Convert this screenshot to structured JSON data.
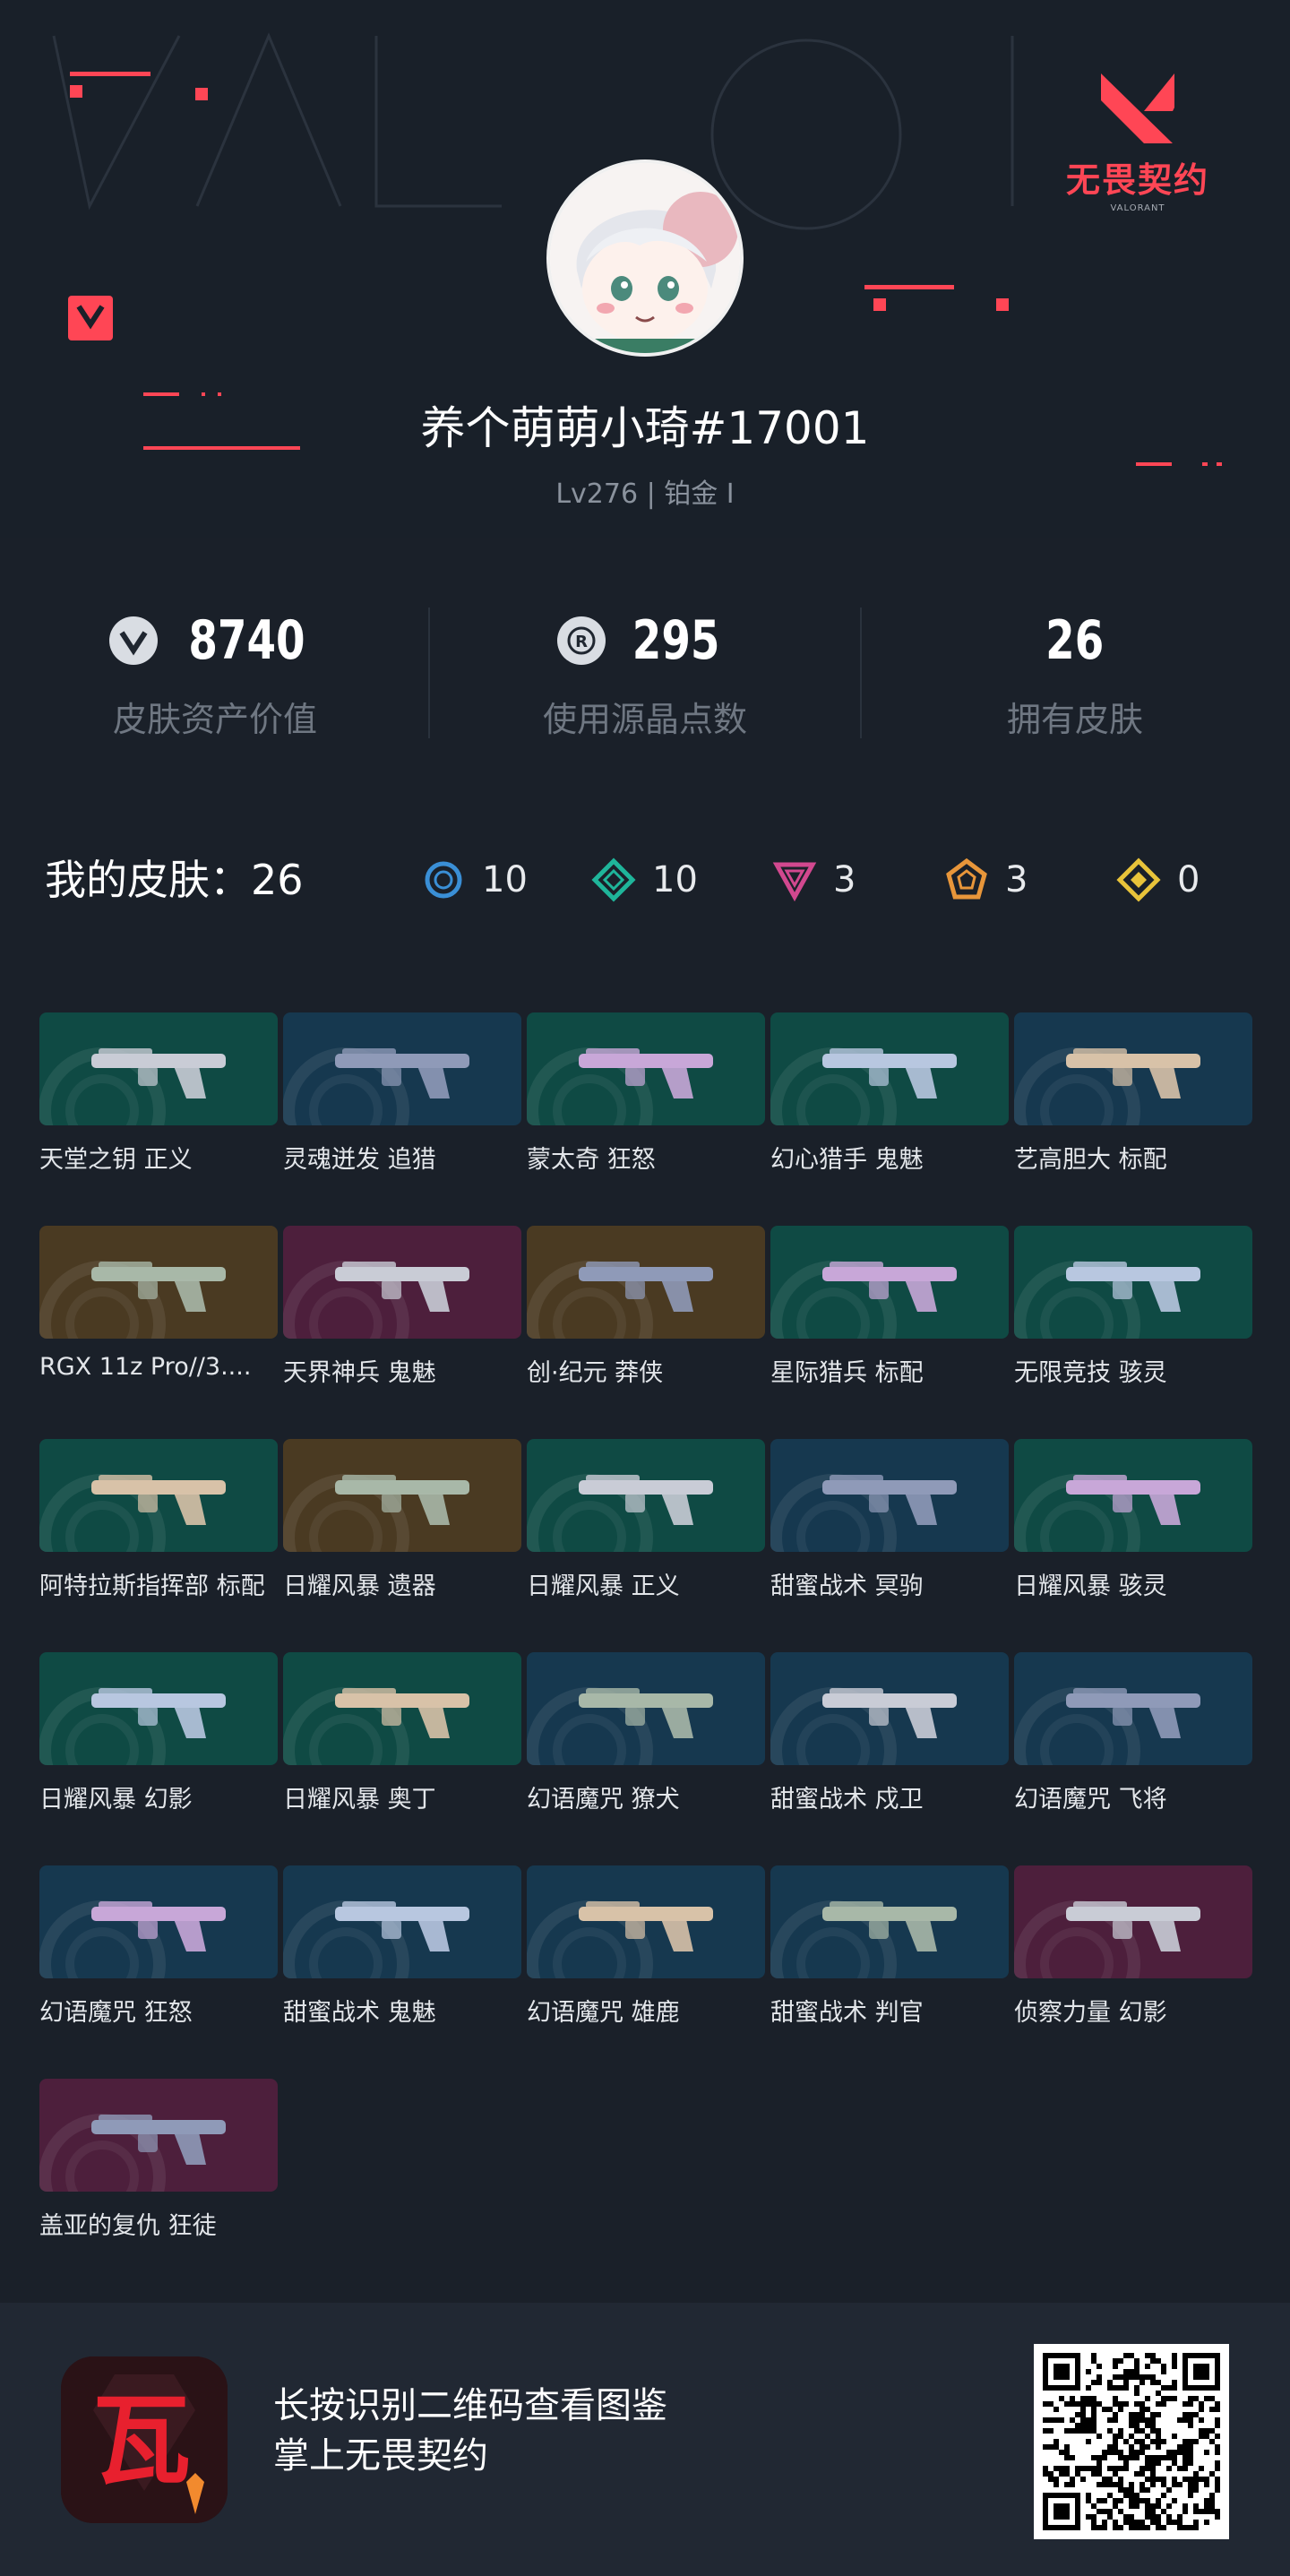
{
  "header": {
    "brand_name": "无畏契约",
    "brand_sub": "VALORANT"
  },
  "profile": {
    "name": "养个萌萌小琦#17001",
    "level": "Lv276 | 铂金 I"
  },
  "stats": [
    {
      "icon": "vp-icon",
      "value": "8740",
      "label": "皮肤资产价值"
    },
    {
      "icon": "radianite-icon",
      "value": "295",
      "label": "使用源晶点数"
    },
    {
      "icon": "",
      "value": "26",
      "label": "拥有皮肤"
    }
  ],
  "summary": {
    "title": "我的皮肤：26",
    "tiers": [
      {
        "icon": "select-tier-icon",
        "color": "#3a8fd6",
        "count": "10"
      },
      {
        "icon": "deluxe-tier-icon",
        "color": "#1fb59a",
        "count": "10"
      },
      {
        "icon": "premium-tier-icon",
        "color": "#d2488f",
        "count": "3"
      },
      {
        "icon": "exclusive-tier-icon",
        "color": "#e8963a",
        "count": "3"
      },
      {
        "icon": "ultra-tier-icon",
        "color": "#e8c33a",
        "count": "0"
      }
    ]
  },
  "skins": [
    {
      "name": "天堂之钥 正义",
      "tier": "deluxe"
    },
    {
      "name": "灵魂迸发 追猎",
      "tier": "select"
    },
    {
      "name": "蒙太奇 狂怒",
      "tier": "deluxe"
    },
    {
      "name": "幻心猎手 鬼魅",
      "tier": "deluxe"
    },
    {
      "name": "艺高胆大 标配",
      "tier": "select"
    },
    {
      "name": "RGX 11z Pro//3....",
      "tier": "exclusive"
    },
    {
      "name": "天界神兵 鬼魅",
      "tier": "premium"
    },
    {
      "name": "创·纪元 莽侠",
      "tier": "exclusive"
    },
    {
      "name": "星际猎兵 标配",
      "tier": "deluxe"
    },
    {
      "name": "无限竞技 骇灵",
      "tier": "deluxe"
    },
    {
      "name": "阿特拉斯指挥部 标配",
      "tier": "deluxe"
    },
    {
      "name": "日耀风暴 遗器",
      "tier": "exclusive"
    },
    {
      "name": "日耀风暴 正义",
      "tier": "deluxe"
    },
    {
      "name": "甜蜜战术 冥驹",
      "tier": "select"
    },
    {
      "name": "日耀风暴 骇灵",
      "tier": "deluxe"
    },
    {
      "name": "日耀风暴 幻影",
      "tier": "deluxe"
    },
    {
      "name": "日耀风暴 奥丁",
      "tier": "deluxe"
    },
    {
      "name": "幻语魔咒 獠犬",
      "tier": "select"
    },
    {
      "name": "甜蜜战术 戍卫",
      "tier": "select"
    },
    {
      "name": "幻语魔咒 飞将",
      "tier": "select"
    },
    {
      "name": "幻语魔咒 狂怒",
      "tier": "select"
    },
    {
      "name": "甜蜜战术 鬼魅",
      "tier": "select"
    },
    {
      "name": "幻语魔咒 雄鹿",
      "tier": "select"
    },
    {
      "name": "甜蜜战术 判官",
      "tier": "select"
    },
    {
      "name": "侦察力量 幻影",
      "tier": "premium"
    },
    {
      "name": "盖亚的复仇 狂徒",
      "tier": "premium"
    }
  ],
  "tier_colors": {
    "select": "#16384f",
    "deluxe": "#0f4a44",
    "premium": "#4d1f3c",
    "exclusive": "#4a3a22"
  },
  "footer": {
    "line1": "长按识别二维码查看图鉴",
    "line2": "掌上无畏契约",
    "app_icon_char": "瓦"
  }
}
